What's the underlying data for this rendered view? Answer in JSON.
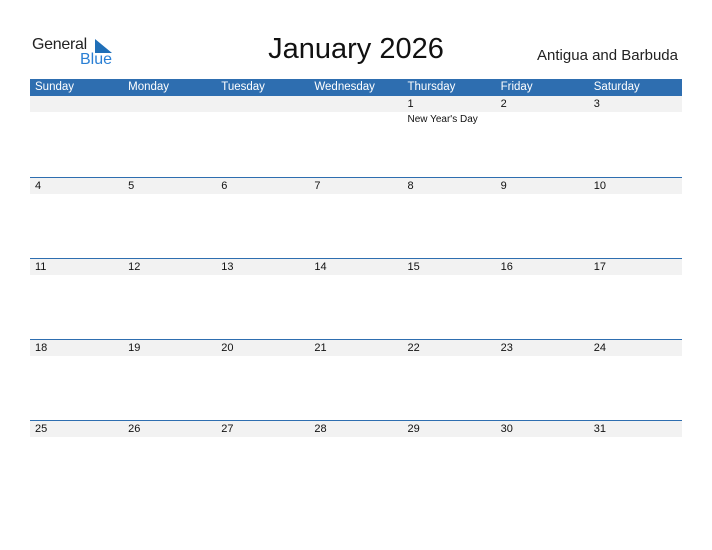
{
  "logo": {
    "general": "General",
    "blue": "Blue"
  },
  "title": "January 2026",
  "country": "Antigua and Barbuda",
  "weekdays": [
    "Sunday",
    "Monday",
    "Tuesday",
    "Wednesday",
    "Thursday",
    "Friday",
    "Saturday"
  ],
  "weeks": [
    {
      "days": [
        "",
        "",
        "",
        "",
        "1",
        "2",
        "3"
      ],
      "events": [
        "",
        "",
        "",
        "",
        "New Year's Day",
        "",
        ""
      ]
    },
    {
      "days": [
        "4",
        "5",
        "6",
        "7",
        "8",
        "9",
        "10"
      ],
      "events": [
        "",
        "",
        "",
        "",
        "",
        "",
        ""
      ]
    },
    {
      "days": [
        "11",
        "12",
        "13",
        "14",
        "15",
        "16",
        "17"
      ],
      "events": [
        "",
        "",
        "",
        "",
        "",
        "",
        ""
      ]
    },
    {
      "days": [
        "18",
        "19",
        "20",
        "21",
        "22",
        "23",
        "24"
      ],
      "events": [
        "",
        "",
        "",
        "",
        "",
        "",
        ""
      ]
    },
    {
      "days": [
        "25",
        "26",
        "27",
        "28",
        "29",
        "30",
        "31"
      ],
      "events": [
        "",
        "",
        "",
        "",
        "",
        "",
        ""
      ]
    }
  ],
  "colors": {
    "header": "#2e6eb0",
    "strip": "#f2f2f2",
    "logo_blue": "#2a7fd4"
  }
}
